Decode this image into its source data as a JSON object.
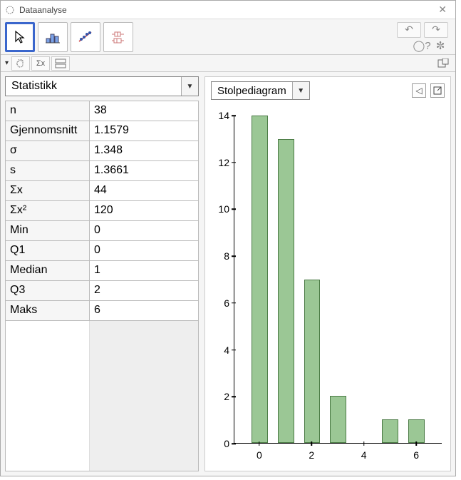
{
  "window": {
    "title": "Dataanalyse"
  },
  "left": {
    "dropdown_label": "Statistikk"
  },
  "right": {
    "dropdown_label": "Stolpediagram"
  },
  "stats": [
    {
      "k": "n",
      "v": "38"
    },
    {
      "k": "Gjennomsnitt",
      "v": "1.1579"
    },
    {
      "k": "σ",
      "v": "1.348"
    },
    {
      "k": "s",
      "v": "1.3661"
    },
    {
      "k": "Σx",
      "v": "44"
    },
    {
      "k": "Σx²",
      "v": "120"
    },
    {
      "k": "Min",
      "v": "0"
    },
    {
      "k": "Q1",
      "v": "0"
    },
    {
      "k": "Median",
      "v": "1"
    },
    {
      "k": "Q3",
      "v": "2"
    },
    {
      "k": "Maks",
      "v": "6"
    }
  ],
  "chart_data": {
    "type": "bar",
    "title": "",
    "xlabel": "",
    "ylabel": "",
    "categories": [
      0,
      1,
      2,
      3,
      4,
      5,
      6
    ],
    "values": [
      14,
      13,
      7,
      2,
      0,
      1,
      1
    ],
    "ylim": [
      0,
      14
    ],
    "yticks": [
      0,
      2,
      4,
      6,
      8,
      10,
      12,
      14
    ],
    "xticks": [
      0,
      2,
      4,
      6
    ]
  }
}
